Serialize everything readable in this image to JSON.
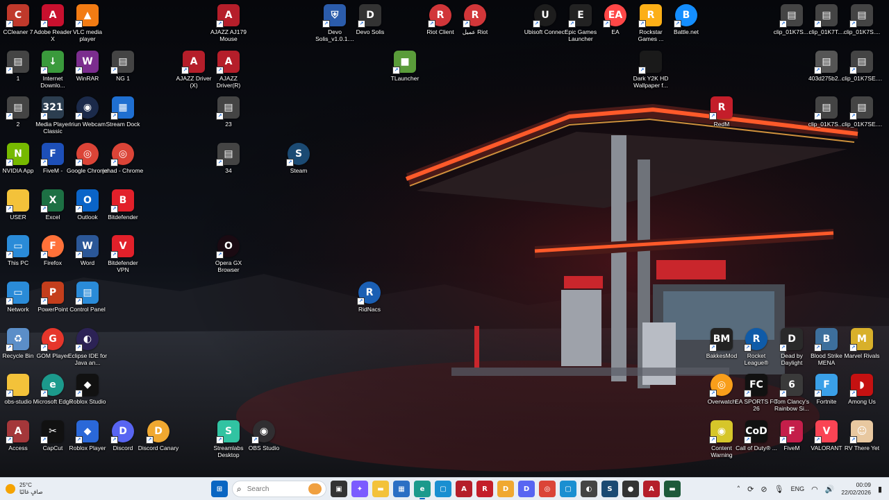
{
  "desktop": {
    "icons": [
      {
        "label": "CCleaner 7",
        "glyph": "C",
        "bg": "#c0392b",
        "icon": "ccleaner-icon"
      },
      {
        "label": "Adobe Reader X",
        "glyph": "A",
        "bg": "#c8102e",
        "icon": "adobe-reader-icon"
      },
      {
        "label": "VLC media player",
        "glyph": "▲",
        "bg": "#f27b13",
        "icon": "vlc-icon"
      },
      {
        "label": "AJAZZ AJ179 Mouse",
        "glyph": "A",
        "bg": "#b51e2a",
        "icon": "ajazz-icon"
      },
      {
        "label": "Devo Solis_v1.0.1....",
        "glyph": "⛨",
        "bg": "#2b5cab",
        "icon": "shield-icon"
      },
      {
        "label": "Devo Solis",
        "glyph": "D",
        "bg": "#333",
        "icon": "devo-icon"
      },
      {
        "label": "Riot Client",
        "glyph": "R",
        "bg": "#d13639",
        "icon": "riot-icon"
      },
      {
        "label": "عميل Riot",
        "glyph": "R",
        "bg": "#d13639",
        "icon": "riot-icon"
      },
      {
        "label": "Ubisoft Connect",
        "glyph": "U",
        "bg": "#1d1d1d",
        "icon": "ubisoft-icon"
      },
      {
        "label": "Epic Games Launcher",
        "glyph": "E",
        "bg": "#222",
        "icon": "epic-icon"
      },
      {
        "label": "EA",
        "glyph": "EA",
        "bg": "#ff4747",
        "icon": "ea-icon"
      },
      {
        "label": "Rockstar Games ...",
        "glyph": "R",
        "bg": "#fcaf17",
        "icon": "rockstar-icon"
      },
      {
        "label": "Battle.net",
        "glyph": "B",
        "bg": "#148eff",
        "icon": "battlenet-icon"
      },
      {
        "label": "clip_01K7S....",
        "glyph": "▤",
        "bg": "#444",
        "icon": "video-file-icon"
      },
      {
        "label": "clip_01K7T....",
        "glyph": "▤",
        "bg": "#444",
        "icon": "video-file-icon"
      },
      {
        "label": "clip_01K7S....",
        "glyph": "▤",
        "bg": "#444",
        "icon": "video-file-icon"
      },
      {
        "label": "1",
        "glyph": "▤",
        "bg": "#444",
        "icon": "video-file-icon"
      },
      {
        "label": "Internet Downlo...",
        "glyph": "↓",
        "bg": "#3a9a3c",
        "icon": "idm-icon"
      },
      {
        "label": "WinRAR",
        "glyph": "W",
        "bg": "#7b2d8e",
        "icon": "winrar-icon"
      },
      {
        "label": "NG 1",
        "glyph": "▤",
        "bg": "#444",
        "icon": "video-file-icon"
      },
      {
        "label": "AJAZZ Driver (X)",
        "glyph": "A",
        "bg": "#b51e2a",
        "icon": "ajazz-icon"
      },
      {
        "label": "AJAZZ Driver(R)",
        "glyph": "A",
        "bg": "#b51e2a",
        "icon": "ajazz-icon"
      },
      {
        "label": "TLauncher",
        "glyph": "■",
        "bg": "#5a9c3a",
        "icon": "tlauncher-icon"
      },
      {
        "label": "Dark Y2K HD Wallpaper f...",
        "glyph": "",
        "bg": "#1a1a1a",
        "icon": "image-file-icon"
      },
      {
        "label": "403d275b2....",
        "glyph": "▤",
        "bg": "#555",
        "icon": "video-file-icon"
      },
      {
        "label": "clip_01K7SE....",
        "glyph": "▤",
        "bg": "#444",
        "icon": "video-file-icon"
      },
      {
        "label": "2",
        "glyph": "▤",
        "bg": "#444",
        "icon": "video-file-icon"
      },
      {
        "label": "Media Player Classic",
        "glyph": "321",
        "bg": "#2c3e50",
        "icon": "mpc-icon"
      },
      {
        "label": "Iriun Webcam",
        "glyph": "◉",
        "bg": "#1b2a4a",
        "icon": "webcam-icon"
      },
      {
        "label": "Stream Dock",
        "glyph": "▦",
        "bg": "#1f6fd1",
        "icon": "stream-dock-icon"
      },
      {
        "label": "23",
        "glyph": "▤",
        "bg": "#444",
        "icon": "video-file-icon"
      },
      {
        "label": "RedM",
        "glyph": "R",
        "bg": "#c41e2a",
        "icon": "redm-icon"
      },
      {
        "label": "clip_01K7S....",
        "glyph": "▤",
        "bg": "#444",
        "icon": "video-file-icon"
      },
      {
        "label": "clip_01K7SE....",
        "glyph": "▤",
        "bg": "#444",
        "icon": "video-file-icon"
      },
      {
        "label": "NVIDIA App",
        "glyph": "N",
        "bg": "#76b900",
        "icon": "nvidia-icon"
      },
      {
        "label": "FiveM -",
        "glyph": "F",
        "bg": "#1d4fb8",
        "icon": "fivem-icon"
      },
      {
        "label": "Google Chrome",
        "glyph": "◎",
        "bg": "#db4437",
        "icon": "chrome-icon"
      },
      {
        "label": "jehad - Chrome",
        "glyph": "◎",
        "bg": "#db4437",
        "icon": "chrome-icon"
      },
      {
        "label": "34",
        "glyph": "▤",
        "bg": "#444",
        "icon": "video-file-icon"
      },
      {
        "label": "Steam",
        "glyph": "S",
        "bg": "#1b4a73",
        "icon": "steam-icon"
      },
      {
        "label": "USER",
        "glyph": "",
        "bg": "#f3c23a",
        "icon": "folder-icon"
      },
      {
        "label": "Excel",
        "glyph": "X",
        "bg": "#1d7044",
        "icon": "excel-icon"
      },
      {
        "label": "Outlook",
        "glyph": "O",
        "bg": "#0a64c8",
        "icon": "outlook-icon"
      },
      {
        "label": "Bitdefender",
        "glyph": "B",
        "bg": "#e2202a",
        "icon": "bitdefender-icon"
      },
      {
        "label": "This PC",
        "glyph": "▭",
        "bg": "#2a8bd8",
        "icon": "computer-icon"
      },
      {
        "label": "Firefox",
        "glyph": "F",
        "bg": "#ff7139",
        "icon": "firefox-icon"
      },
      {
        "label": "Word",
        "glyph": "W",
        "bg": "#2b5797",
        "icon": "word-icon"
      },
      {
        "label": "Bitdefender VPN",
        "glyph": "V",
        "bg": "#e2202a",
        "icon": "bitdefender-vpn-icon"
      },
      {
        "label": "Opera GX Browser",
        "glyph": "O",
        "bg": "#1a0a12",
        "icon": "opera-gx-icon"
      },
      {
        "label": "RidNacs",
        "glyph": "R",
        "bg": "#1b5fb3",
        "icon": "ridnacs-icon"
      },
      {
        "label": "Network",
        "glyph": "▭",
        "bg": "#2a8bd8",
        "icon": "network-icon"
      },
      {
        "label": "PowerPoint",
        "glyph": "P",
        "bg": "#c43e1c",
        "icon": "powerpoint-icon"
      },
      {
        "label": "Control Panel",
        "glyph": "▤",
        "bg": "#2a8bd8",
        "icon": "control-panel-icon"
      },
      {
        "label": "Recycle Bin",
        "glyph": "♻",
        "bg": "#5b8ec8",
        "icon": "recycle-bin-icon"
      },
      {
        "label": "GOM Player",
        "glyph": "G",
        "bg": "#e6362b",
        "icon": "gom-player-icon"
      },
      {
        "label": "Eclipse IDE for Java an...",
        "glyph": "◐",
        "bg": "#2c2255",
        "icon": "eclipse-icon"
      },
      {
        "label": "BakkesMod",
        "glyph": "BM",
        "bg": "#222",
        "icon": "bakkesmod-icon"
      },
      {
        "label": "Rocket League®",
        "glyph": "R",
        "bg": "#0f5ba8",
        "icon": "rocket-league-icon"
      },
      {
        "label": "Dead by Daylight",
        "glyph": "D",
        "bg": "#2a2a2a",
        "icon": "dbd-icon"
      },
      {
        "label": "Blood Strike MENA",
        "glyph": "B",
        "bg": "#3d6f9c",
        "icon": "blood-strike-icon"
      },
      {
        "label": "Marvel Rivals",
        "glyph": "M",
        "bg": "#d8b02a",
        "icon": "marvel-rivals-icon"
      },
      {
        "label": "obs-studio",
        "glyph": "",
        "bg": "#f3c23a",
        "icon": "folder-icon"
      },
      {
        "label": "Microsoft Edge",
        "glyph": "e",
        "bg": "#1c9a8c",
        "icon": "edge-icon"
      },
      {
        "label": "Roblox Studio",
        "glyph": "◆",
        "bg": "#111",
        "icon": "roblox-studio-icon"
      },
      {
        "label": "Overwatch",
        "glyph": "◎",
        "bg": "#f99e1a",
        "icon": "overwatch-icon"
      },
      {
        "label": "EA SPORTS FC 26",
        "glyph": "FC",
        "bg": "#111",
        "icon": "eafc-icon"
      },
      {
        "label": "Tom Clancy's Rainbow Si...",
        "glyph": "6",
        "bg": "#3a3a3a",
        "icon": "r6-icon"
      },
      {
        "label": "Fortnite",
        "glyph": "F",
        "bg": "#3aa0e8",
        "icon": "fortnite-icon"
      },
      {
        "label": "Among Us",
        "glyph": "◗",
        "bg": "#c51111",
        "icon": "among-us-icon"
      },
      {
        "label": "Access",
        "glyph": "A",
        "bg": "#a4373a",
        "icon": "access-icon"
      },
      {
        "label": "CapCut",
        "glyph": "✂",
        "bg": "#111",
        "icon": "capcut-icon"
      },
      {
        "label": "Roblox Player",
        "glyph": "◆",
        "bg": "#2a68d8",
        "icon": "roblox-icon"
      },
      {
        "label": "Discord",
        "glyph": "D",
        "bg": "#5865f2",
        "icon": "discord-icon"
      },
      {
        "label": "Discord Canary",
        "glyph": "D",
        "bg": "#f0a830",
        "icon": "discord-canary-icon"
      },
      {
        "label": "Streamlabs Desktop",
        "glyph": "S",
        "bg": "#31c3a2",
        "icon": "streamlabs-icon"
      },
      {
        "label": "OBS Studio",
        "glyph": "◉",
        "bg": "#302e31",
        "icon": "obs-icon"
      },
      {
        "label": "Content Warning",
        "glyph": "◉",
        "bg": "#d6c62a",
        "icon": "content-warning-icon"
      },
      {
        "label": "Call of Duty® ...",
        "glyph": "CoD",
        "bg": "#111",
        "icon": "cod-icon"
      },
      {
        "label": "FiveM",
        "glyph": "F",
        "bg": "#c41e4a",
        "icon": "fivem-icon"
      },
      {
        "label": "VALORANT",
        "glyph": "V",
        "bg": "#fa4454",
        "icon": "valorant-icon"
      },
      {
        "label": "RV There Yet",
        "glyph": "☺",
        "bg": "#e8c8a0",
        "icon": "rv-there-yet-icon"
      }
    ]
  },
  "taskbar": {
    "weather": {
      "temp": "25°C",
      "desc": "صافٍ غالبًا"
    },
    "search": {
      "placeholder": "Search"
    },
    "apps": [
      {
        "icon": "start-icon",
        "glyph": "⊞",
        "bg": "#0a66c2"
      },
      {
        "icon": "task-view-icon",
        "glyph": "▣",
        "bg": "#333"
      },
      {
        "icon": "copilot-icon",
        "glyph": "✦",
        "bg": "#7b5cff"
      },
      {
        "icon": "file-explorer-icon",
        "glyph": "▬",
        "bg": "#f3c23a"
      },
      {
        "icon": "store-icon",
        "glyph": "▦",
        "bg": "#2b6fc4"
      },
      {
        "icon": "edge-icon",
        "glyph": "e",
        "bg": "#1c9a8c",
        "active": true
      },
      {
        "icon": "app-icon",
        "glyph": "▢",
        "bg": "#1a8fd1"
      },
      {
        "icon": "ajazz-icon",
        "glyph": "A",
        "bg": "#b51e2a"
      },
      {
        "icon": "redm-icon",
        "glyph": "R",
        "bg": "#c41e2a"
      },
      {
        "icon": "discord-canary-icon",
        "glyph": "D",
        "bg": "#f0a830"
      },
      {
        "icon": "discord-icon",
        "glyph": "D",
        "bg": "#5865f2"
      },
      {
        "icon": "chrome-icon",
        "glyph": "◎",
        "bg": "#db4437"
      },
      {
        "icon": "app-icon",
        "glyph": "▢",
        "bg": "#1a8fd1"
      },
      {
        "icon": "vpn-icon",
        "glyph": "◐",
        "bg": "#444"
      },
      {
        "icon": "steam-icon",
        "glyph": "S",
        "bg": "#1b4a73"
      },
      {
        "icon": "riot-icon",
        "glyph": "●",
        "bg": "#333"
      },
      {
        "icon": "ajazz-icon",
        "glyph": "A",
        "bg": "#b51e2a"
      },
      {
        "icon": "terminal-icon",
        "glyph": "▬",
        "bg": "#1d5a3a"
      }
    ],
    "tray": {
      "lang": "ENG",
      "time": "00:09",
      "date": "22/02/2026"
    }
  }
}
